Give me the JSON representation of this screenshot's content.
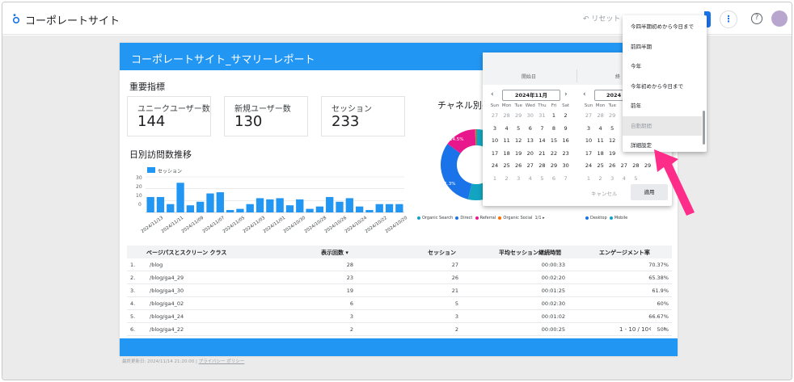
{
  "app": {
    "title": "コーポレートサイト",
    "reset_label": "リセット"
  },
  "report": {
    "title": "コーポレートサイト_サマリーレポート",
    "kpi_section": "重要指標",
    "kpis": [
      {
        "label": "ユニークユーザー数",
        "value": "144"
      },
      {
        "label": "新規ユーザー数",
        "value": "130"
      },
      {
        "label": "セッション",
        "value": "233"
      }
    ],
    "daily_section": "日別訪問数推移",
    "channel_section": "チャネル別の",
    "footnote": "最終更新日: 2024/11/14 21:20:00",
    "footnote_sep": "|",
    "privacy_link": "プライバシー ポリシー"
  },
  "chart_data": [
    {
      "type": "bar",
      "title": "日別訪問数推移",
      "series": [
        {
          "name": "セッション",
          "values": [
            13,
            13,
            7,
            25,
            6,
            9,
            16,
            17,
            2,
            3,
            7,
            12,
            11,
            12,
            6,
            11,
            3,
            5,
            13,
            9,
            12,
            5,
            2,
            7,
            7,
            7
          ]
        }
      ],
      "ylim": [
        0,
        30
      ],
      "yticks": [
        "30",
        "20",
        "10",
        "0"
      ],
      "xtick_labels": [
        "2024/11/13",
        "2024/11/11",
        "2024/11/09",
        "2024/11/07",
        "2024/11/05",
        "2024/11/03",
        "2024/11/01",
        "2024/10/30",
        "2024/10/28",
        "2024/10/26",
        "2024/10/24",
        "2024/10/22",
        "2024/10/20"
      ],
      "legend": "top-left",
      "grid": true
    },
    {
      "type": "pie",
      "title": "チャネル別の",
      "categories": [
        "Organic Search",
        "Direct",
        "Referral",
        "Organic Social"
      ],
      "values": [
        53.7,
        31.3,
        14.5,
        0.5
      ],
      "labels": [
        "11.3%",
        "14.5%"
      ],
      "colors": [
        "#12a4c0",
        "#1a73e8",
        "#e8188c",
        "#ff6d00"
      ],
      "legend_labels": [
        "Organic Search",
        "Direct",
        "Referral",
        "Organic Social"
      ],
      "legend_page": "1/1",
      "legend_b": [
        "Desktop",
        "Mobile"
      ]
    }
  ],
  "table": {
    "headers": [
      "ページパスとスクリーン クラス",
      "表示回数 ▾",
      "セッション",
      "平均セッション継続時間",
      "エンゲージメント率"
    ],
    "rows": [
      {
        "idx": "1.",
        "path": "/blog",
        "views": "28",
        "sessions": "27",
        "duration": "00:00:33",
        "rate": "70.37%"
      },
      {
        "idx": "2.",
        "path": "/blog/ga4_29",
        "views": "23",
        "sessions": "26",
        "duration": "00:02:20",
        "rate": "65.38%"
      },
      {
        "idx": "3.",
        "path": "/blog/ga4_30",
        "views": "19",
        "sessions": "21",
        "duration": "00:01:25",
        "rate": "61.9%"
      },
      {
        "idx": "4.",
        "path": "/blog/ga4_02",
        "views": "6",
        "sessions": "5",
        "duration": "00:02:30",
        "rate": "60%"
      },
      {
        "idx": "5.",
        "path": "/blog/ga4_24",
        "views": "3",
        "sessions": "3",
        "duration": "00:01:02",
        "rate": "66.67%"
      },
      {
        "idx": "6.",
        "path": "/blog/ga4_22",
        "views": "2",
        "sessions": "2",
        "duration": "00:00:25",
        "rate": "50%"
      }
    ],
    "pager": "1 - 10 / 10"
  },
  "datepicker": {
    "start_label": "開始日",
    "end_label": "終",
    "left_month": "2024年11月",
    "right_month": "2024",
    "weekdays": [
      "Sun",
      "Mon",
      "Tue",
      "Wed",
      "Thu",
      "Fri",
      "Sat"
    ],
    "left_days": [
      [
        "27",
        "28",
        "29",
        "30",
        "31",
        "1",
        "2"
      ],
      [
        "3",
        "4",
        "5",
        "6",
        "7",
        "8",
        "9"
      ],
      [
        "10",
        "11",
        "12",
        "13",
        "14",
        "15",
        "16"
      ],
      [
        "17",
        "18",
        "19",
        "20",
        "21",
        "22",
        "23"
      ],
      [
        "24",
        "25",
        "26",
        "27",
        "28",
        "29",
        "30"
      ],
      [
        "1",
        "2",
        "3",
        "4",
        "5",
        "6",
        "7"
      ]
    ],
    "right_days": [
      [
        "27",
        "28",
        "29"
      ],
      [
        "3",
        "4",
        "5"
      ],
      [
        "10",
        "11",
        "12"
      ],
      [
        "17",
        "18",
        "19"
      ],
      [
        "24",
        "25",
        "26",
        "27",
        "28",
        "29"
      ],
      [
        "1",
        "2",
        "3",
        "4",
        "5"
      ]
    ],
    "cancel_label": "キャンセル",
    "apply_label": "適用"
  },
  "menu": {
    "items": [
      {
        "label": "今四半期初めから今日まで",
        "selected": false
      },
      {
        "label": "前四半期",
        "selected": false
      },
      {
        "label": "今年",
        "selected": false
      },
      {
        "label": "今年初めから今日まで",
        "selected": false
      },
      {
        "label": "前年",
        "selected": false
      },
      {
        "label": "自動期間",
        "selected": true
      },
      {
        "label": "詳細設定",
        "selected": false
      }
    ]
  },
  "colors": {
    "accent": "#2196f3",
    "annotation": "#ff2d8a"
  }
}
